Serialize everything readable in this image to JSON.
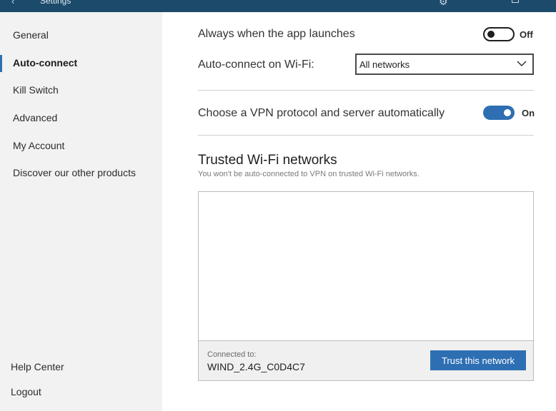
{
  "window": {
    "title": "Settings",
    "back_glyph": "‹",
    "settings_glyph": "⚙"
  },
  "sidebar": {
    "items": [
      {
        "label": "General"
      },
      {
        "label": "Auto-connect",
        "active": true
      },
      {
        "label": "Kill Switch"
      },
      {
        "label": "Advanced"
      },
      {
        "label": "My Account"
      },
      {
        "label": "Discover our other products"
      }
    ],
    "bottom": [
      {
        "label": "Help Center"
      },
      {
        "label": "Logout"
      }
    ]
  },
  "main": {
    "launch_row": {
      "label": "Always when the app launches",
      "state": "Off"
    },
    "wifi_row": {
      "label": "Auto-connect on Wi-Fi:",
      "selected": "All networks"
    },
    "protocol_row": {
      "label": "Choose a VPN protocol and server automatically",
      "state": "On"
    },
    "trusted": {
      "title": "Trusted Wi-Fi networks",
      "subtitle": "You won't be auto-connected to VPN on trusted Wi-Fi networks.",
      "connected_label": "Connected to:",
      "connected_network": "WIND_2.4G_C0D4C7",
      "trust_button": "Trust this network"
    }
  },
  "colors": {
    "accent": "#2e6fb3",
    "titlebar": "#1b4a6b",
    "sidebar_bg": "#f2f2f2"
  }
}
